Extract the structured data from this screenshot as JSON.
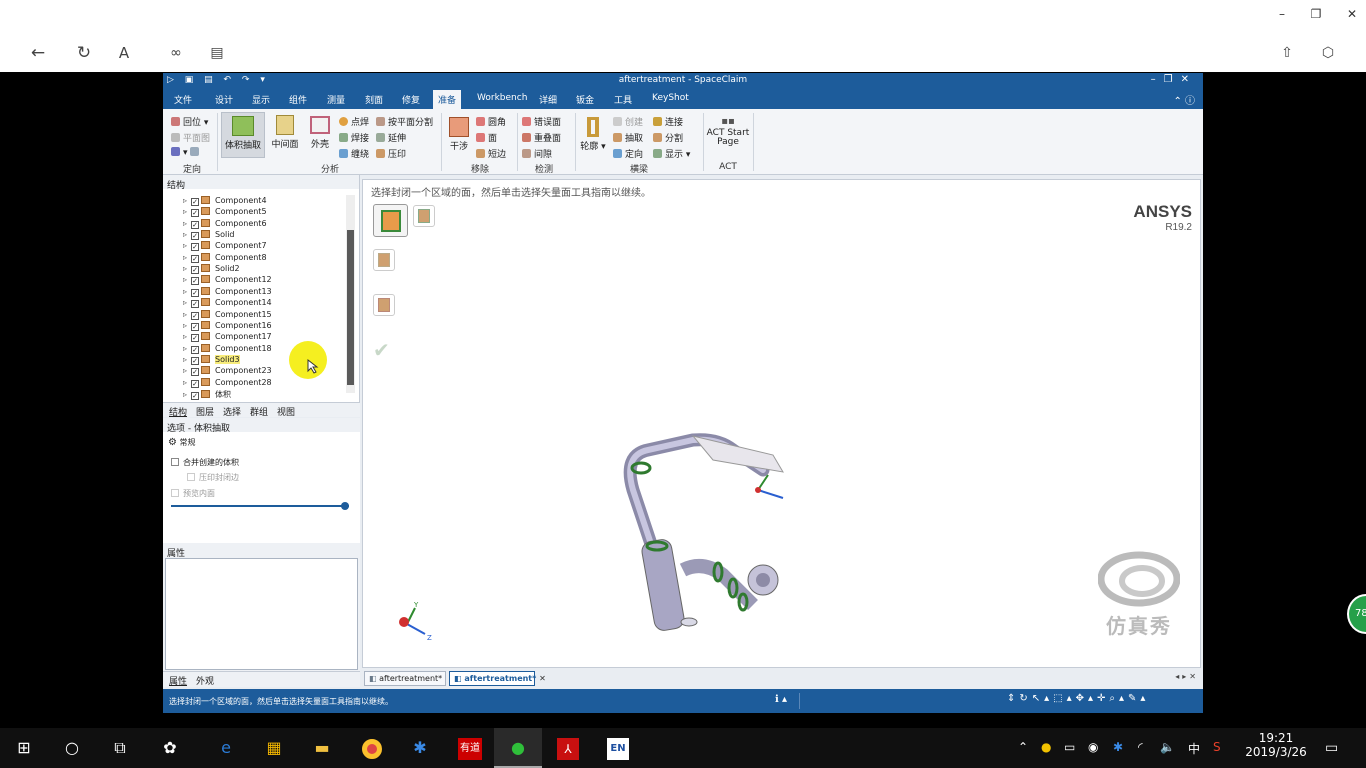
{
  "browser": {
    "window_buttons": [
      "–",
      "❐",
      "✕"
    ],
    "nav_icons": [
      "back-icon",
      "refresh-icon",
      "reader-icon",
      "link-icon",
      "tab-icon",
      "share-icon",
      "3d-icon"
    ]
  },
  "app": {
    "title": "aftertreatment - SpaceClaim",
    "menus": [
      "文件",
      "设计",
      "显示",
      "组件",
      "测量",
      "刻面",
      "修复",
      "准备",
      "Workbench",
      "详细",
      "钣金",
      "工具",
      "KeyShot"
    ],
    "active_menu": "准备",
    "ribbon": {
      "orient": {
        "items": [
          "回位",
          "平面图"
        ],
        "label": "定向"
      },
      "analysis": {
        "big": [
          "体积抽取",
          "中间面",
          "外壳"
        ],
        "small": [
          "点焊",
          "焊接",
          "缠绕",
          "按平面分割",
          "延伸",
          "压印"
        ],
        "label": "分析"
      },
      "remove": {
        "big": "干涉",
        "small": [
          "圆角",
          "面",
          "短边"
        ],
        "label": "移除"
      },
      "detect": {
        "small": [
          "错误面",
          "重叠面",
          "间隙"
        ],
        "label": "检测"
      },
      "beam": {
        "big": "轮廓",
        "small": [
          "创建",
          "抽取",
          "定向",
          "连接",
          "分割",
          "显示"
        ],
        "label": "横梁"
      },
      "act": {
        "big": "ACT Start Page",
        "label": "ACT"
      }
    },
    "structure": {
      "header": "结构",
      "items": [
        "Component4",
        "Component5",
        "Component6",
        "Solid",
        "Component7",
        "Component8",
        "Solid2",
        "Component12",
        "Component13",
        "Component14",
        "Component15",
        "Component16",
        "Component17",
        "Component18",
        "Solid3",
        "Component23",
        "Component28",
        "体积"
      ],
      "highlighted": "Solid3"
    },
    "panel_tabs": [
      "结构",
      "图层",
      "选择",
      "群组",
      "视图"
    ],
    "options": {
      "header": "选项 - 体积抽取",
      "section": "常规",
      "merge_label": "合并创建的体积",
      "imprint_label": "压印封闭边",
      "preview_label": "预览内面"
    },
    "properties": {
      "header": "属性"
    },
    "bottom_tabs": [
      "属性",
      "外观"
    ],
    "viewport": {
      "prompt": "选择封闭一个区域的面，然后单击选择矢量面工具指南以继续。",
      "brand": "ANSYS",
      "version": "R19.2",
      "watermark": "仿真秀",
      "axis_labels": {
        "y": "Y",
        "z": "Z"
      }
    },
    "doc_tabs": [
      "aftertreatment*",
      "aftertreatment*"
    ],
    "status_text": "选择封闭一个区域的面，然后单击选择矢量面工具指南以继续。"
  },
  "taskbar": {
    "time": "19:21",
    "date": "2019/3/26",
    "ime": "中",
    "badge": "78",
    "apps": [
      "windows-icon",
      "search-icon",
      "taskview-icon",
      "app1-icon",
      "edge-icon",
      "store-icon",
      "explorer-icon",
      "chrome-icon",
      "app2-icon",
      "youdao-icon",
      "wechat-icon",
      "acrobat-icon",
      "en-icon"
    ]
  },
  "colors": {
    "accent": "#1d5c9b",
    "ribbon_bg": "#f3f5f8",
    "highlight": "#f7ec7b"
  }
}
